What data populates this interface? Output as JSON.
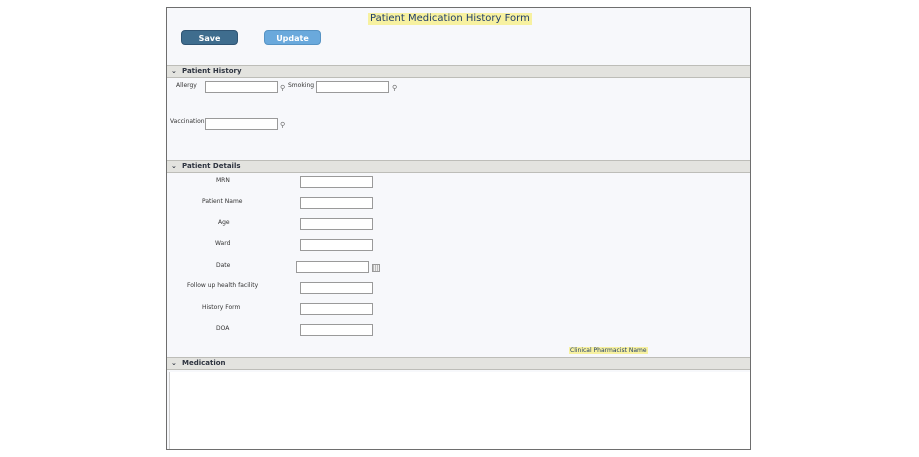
{
  "form": {
    "title": "Patient Medication History Form",
    "save_label": "Save",
    "update_label": "Update"
  },
  "patient_history": {
    "header": "Patient History",
    "allergy_label": "Allergy",
    "smoking_label": "Smoking",
    "vaccination_label": "Vaccination",
    "allergy_value": "",
    "smoking_value": "",
    "vaccination_value": ""
  },
  "patient_details": {
    "header": "Patient Details",
    "fields": [
      {
        "label": "MRN",
        "value": ""
      },
      {
        "label": "Patient Name",
        "value": ""
      },
      {
        "label": "Age",
        "value": ""
      },
      {
        "label": "Ward",
        "value": ""
      },
      {
        "label": "Date",
        "value": ""
      },
      {
        "label": "Follow up health facility",
        "value": ""
      },
      {
        "label": "History Form",
        "value": ""
      },
      {
        "label": "DOA",
        "value": ""
      }
    ],
    "pharmacist_label": "Clinical Pharmacist Name"
  },
  "medication": {
    "header": "Medication"
  },
  "icons": {
    "section_toggle": "chevron-down-icon",
    "lookup": "search-icon",
    "date_picker": "calendar-icon"
  },
  "colors": {
    "save_button": "#3f6d8e",
    "update_button": "#6aa9dc",
    "highlight": "#f7f1a0",
    "section_header": "#e3e3df"
  }
}
